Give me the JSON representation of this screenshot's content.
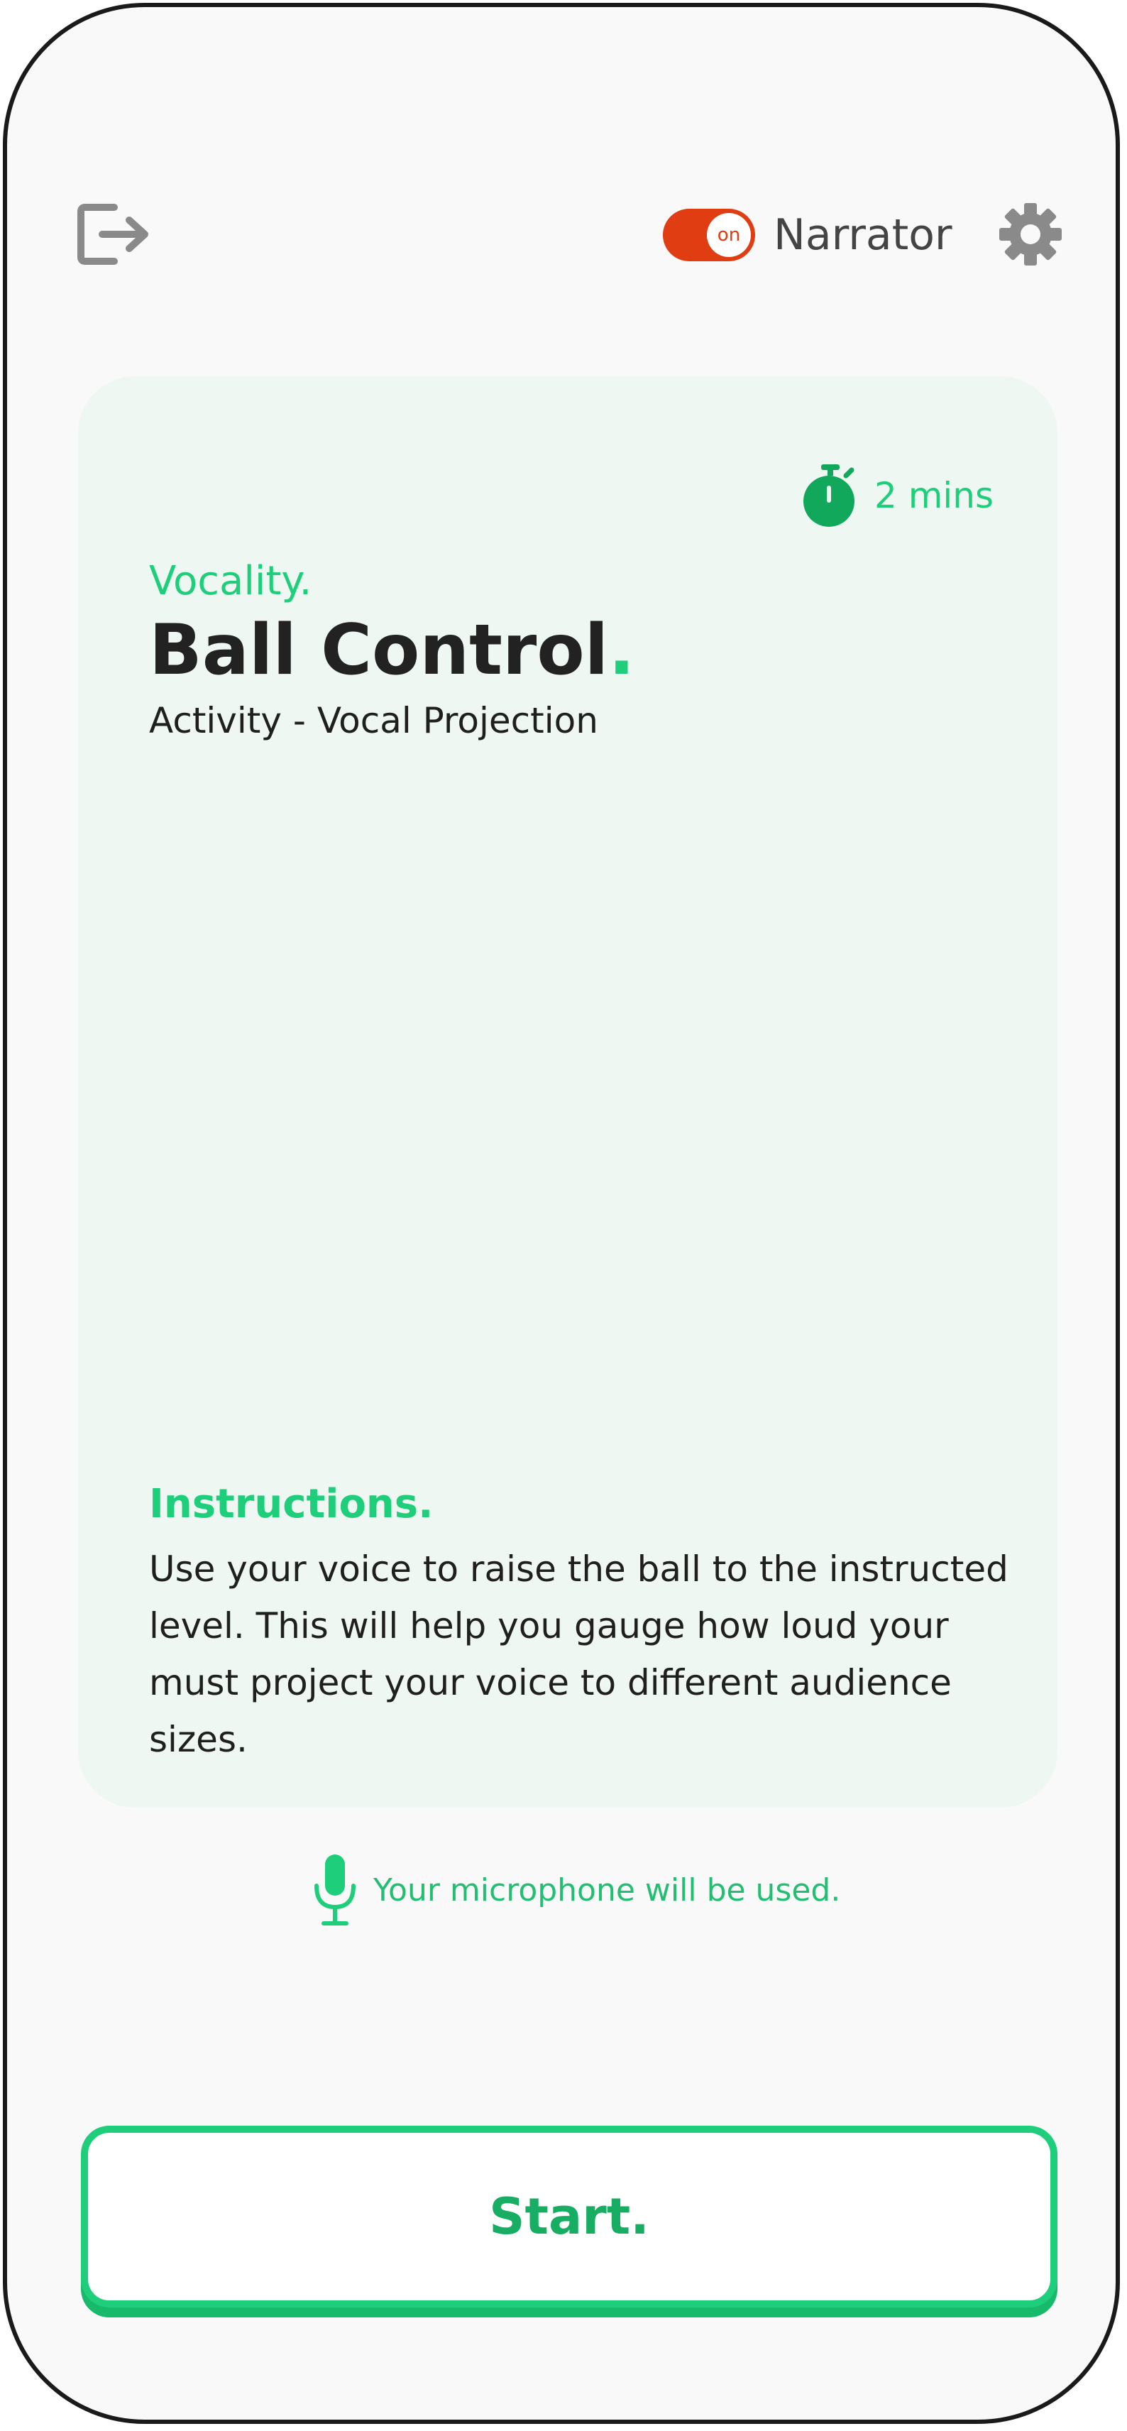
{
  "header": {
    "narrator_label": "Narrator",
    "narrator_toggle_text": "on",
    "narrator_on": true
  },
  "card": {
    "duration": "2 mins",
    "brand": "Vocality.",
    "title": "Ball Control",
    "title_accent": ".",
    "subtitle": "Activity - Vocal Projection",
    "instructions_heading": "Instructions.",
    "instructions_body": "Use your voice to raise the ball to the instructed level. This will help you gauge how loud your must project your voice to different audience sizes."
  },
  "microphone_notice": "Your microphone will be used.",
  "start_button_label": "Start.",
  "colors": {
    "accent_green": "#1fce7a",
    "toggle_on": "#e03d12",
    "card_background": "#eef7f1",
    "icon_gray": "#8a8a8a"
  },
  "icons": {
    "exit": "exit-icon",
    "settings": "gear-icon",
    "timer": "stopwatch-icon",
    "microphone": "microphone-icon"
  }
}
